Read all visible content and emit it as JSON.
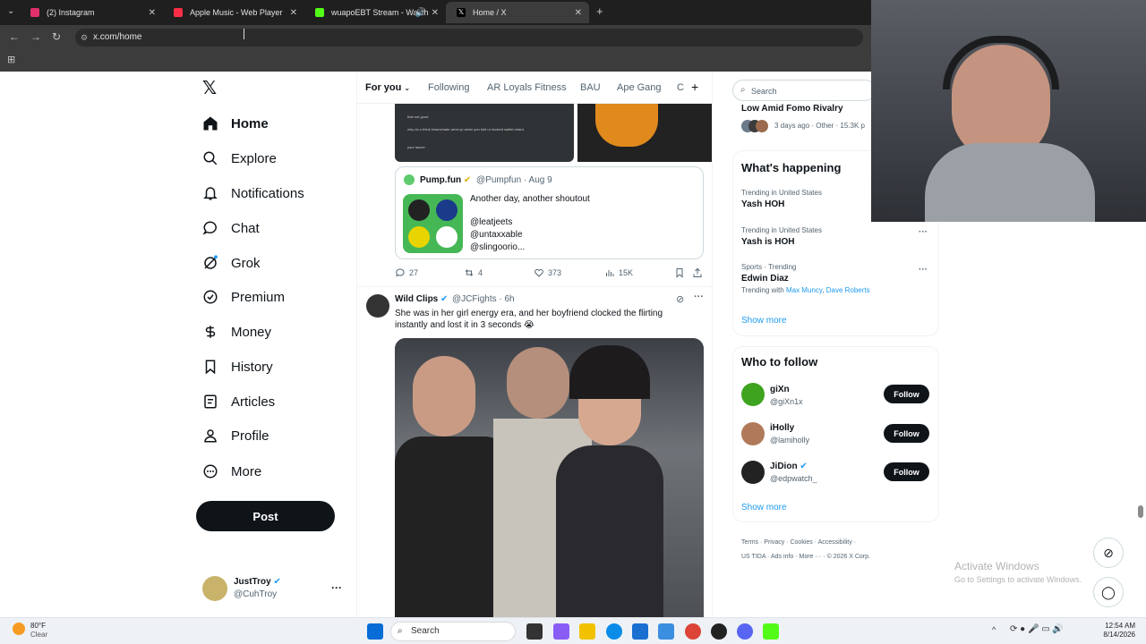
{
  "browser": {
    "tabs": [
      {
        "title": "(2) Instagram",
        "color": "#e1306c"
      },
      {
        "title": "Apple Music - Web Player",
        "color": "#fa2d48"
      },
      {
        "title": "wuapoEBT Stream - Watch",
        "color": "#53fc18"
      },
      {
        "title": "Home / X",
        "color": "#ffffff"
      }
    ],
    "url": "x.com/home"
  },
  "sidebar": {
    "items": [
      {
        "label": "Home",
        "icon": "home-icon"
      },
      {
        "label": "Explore",
        "icon": "search-icon"
      },
      {
        "label": "Notifications",
        "icon": "bell-icon"
      },
      {
        "label": "Chat",
        "icon": "chat-icon"
      },
      {
        "label": "Grok",
        "icon": "grok-icon"
      },
      {
        "label": "Premium",
        "icon": "premium-icon"
      },
      {
        "label": "Money",
        "icon": "money-icon"
      },
      {
        "label": "History",
        "icon": "bookmark-icon"
      },
      {
        "label": "Articles",
        "icon": "articles-icon"
      },
      {
        "label": "Profile",
        "icon": "profile-icon"
      },
      {
        "label": "More",
        "icon": "more-icon"
      }
    ],
    "post_label": "Post",
    "account": {
      "name": "JustTroy",
      "handle": "@CuhTroy"
    }
  },
  "feed": {
    "tabs": [
      "For you",
      "Following",
      "AR Loyals Fitness",
      "BAU",
      "Ape Gang",
      "C"
    ],
    "quote": {
      "name": "Pump.fun",
      "handle": "@Pumpfun",
      "date": "· Aug 9",
      "text": "Another day, another shoutout",
      "mentions": [
        "@leatjeets",
        "@untaxxable",
        "@slingoorio..."
      ]
    },
    "stats": {
      "replies": "27",
      "reposts": "4",
      "likes": "373",
      "views": "15K"
    },
    "post": {
      "name": "Wild Clips",
      "handle": "@JCFights",
      "time": "· 6h",
      "text": "She was in her girl energy era, and her boyfriend clocked the flirting instantly and lost it in 3 seconds 😭"
    },
    "thumb_texts": [
      "that not good",
      "why do u think binanchade went up when you told ur docked wallet retard",
      "your lancer"
    ]
  },
  "right": {
    "search_placeholder": "Search",
    "news": {
      "title": "Low Amid Fomo Rivalry",
      "meta": "3 days ago · Other · 15.3K p"
    },
    "happening": {
      "title": "What's happening",
      "trends": [
        {
          "context": "Trending in United States",
          "name": "Yash HOH",
          "extra": ""
        },
        {
          "context": "Trending in United States",
          "name": "Yash is HOH",
          "extra": ""
        },
        {
          "context": "Sports · Trending",
          "name": "Edwin Diaz",
          "extra": "Trending with"
        }
      ],
      "trend_links": [
        "Max Muncy",
        "Dave Roberts"
      ],
      "show_more": "Show more"
    },
    "who_to_follow": {
      "title": "Who to follow",
      "users": [
        {
          "name": "giXn",
          "handle": "@giXn1x",
          "avatar_color": "#3ea31f"
        },
        {
          "name": "iHolly",
          "handle": "@lamiholly",
          "avatar_color": "#b07a5a"
        },
        {
          "name": "JiDion",
          "handle": "@edpwatch_",
          "avatar_color": "#222222"
        }
      ],
      "follow_label": "Follow",
      "show_more": "Show more"
    },
    "footer": [
      "Terms",
      "Privacy",
      "Cookies",
      "Accessibility",
      "US TIDA",
      "Ads info",
      "More ···",
      "© 2026 X Corp."
    ]
  },
  "watermark": {
    "line1": "Activate Windows",
    "line2": "Go to Settings to activate Windows."
  },
  "taskbar": {
    "weather_temp": "80°F",
    "weather_desc": "Clear",
    "search_label": "Search",
    "time": "12:54 AM",
    "date": "8/14/2026"
  },
  "colors": {
    "accent": "#1d9bf0",
    "text": "#0f1419",
    "muted": "#536471",
    "verified": "#1d9bf0"
  }
}
